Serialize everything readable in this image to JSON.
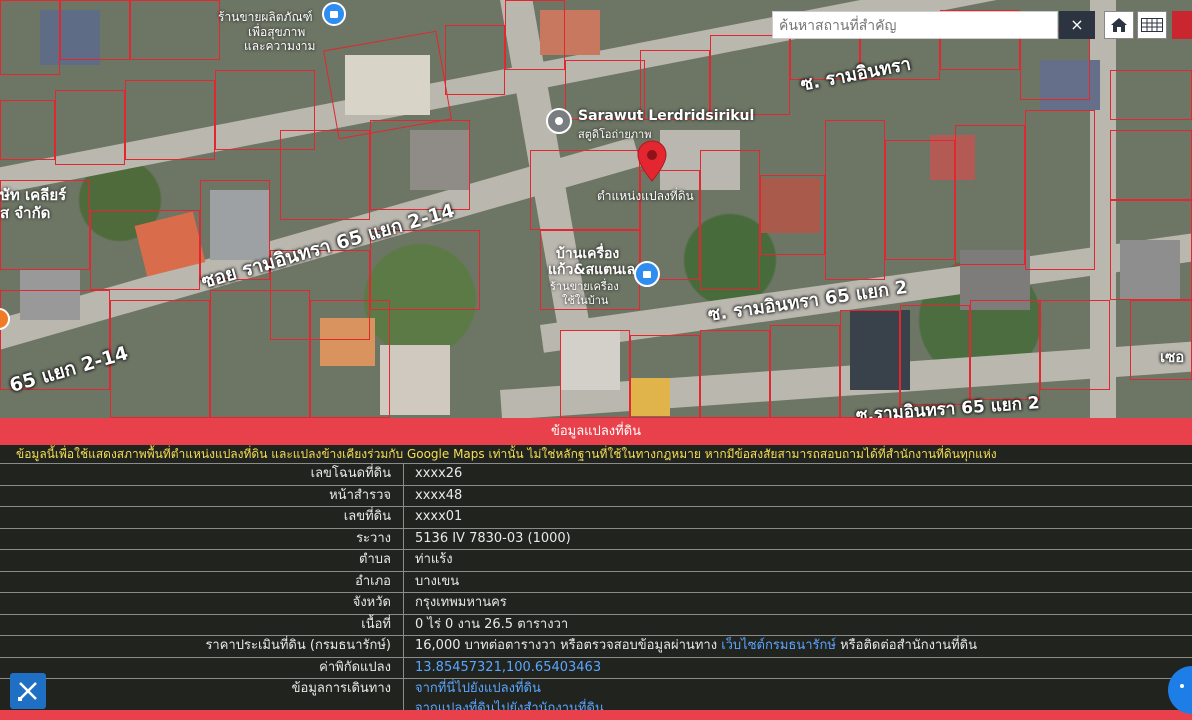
{
  "map": {
    "search_placeholder": "ค้นหาสถานที่สำคัญ",
    "close_label": "×",
    "road_labels": {
      "soi_2_14": "ซอย รามอินทรา 65 แยก 2-14",
      "soi_2_14_left": "65 แยก 2-14",
      "soi_2": "ซ. รามอินทรา 65 แยก 2",
      "soi_top": "ซ. รามอินทรา",
      "soi_bottom_right": "ซ.รามอินทรา 65 แยก 2",
      "edge_right": "เซอ"
    },
    "pois": {
      "sarawut_name": "Sarawut Lerdridsirikul",
      "sarawut_desc": "สตูดิโอถ่ายภาพ",
      "store_name_1": "บ้านเครื่อง",
      "store_name_2": "แก้ว&สแตนเลส",
      "store_desc_1": "ร้านขายเครื่อง",
      "store_desc_2": "ใช้ในบ้าน",
      "top_poi_1": "ร้านขายผลิตภัณฑ์",
      "top_poi_2": "เพื่อสุขภาพ",
      "top_poi_3": "และความงาม",
      "left_poi_1": "ษัท เคลียร์",
      "left_poi_2": "ส จำกัด"
    },
    "pin_label": "ตำแหน่งแปลงที่ดิน"
  },
  "panel": {
    "title": "ข้อมูลแปลงที่ดิน",
    "notice": "ข้อมูลนี้เพื่อใช้แสดงสภาพพื้นที่ตำแหน่งแปลงที่ดิน และแปลงข้างเคียงร่วมกับ Google Maps เท่านั้น ไม่ใช่หลักฐานที่ใช้ในทางกฎหมาย หากมีข้อสงสัยสามารถสอบถามได้ที่สำนักงานที่ดินทุกแห่ง",
    "rows": [
      {
        "label": "เลขโฉนดที่ดิน",
        "value": "xxxx26"
      },
      {
        "label": "หน้าสำรวจ",
        "value": "xxxx48"
      },
      {
        "label": "เลขที่ดิน",
        "value": "xxxx01"
      },
      {
        "label": "ระวาง",
        "value": "5136 IV 7830-03 (1000)"
      },
      {
        "label": "ตำบล",
        "value": "ท่าแร้ง"
      },
      {
        "label": "อำเภอ",
        "value": "บางเขน"
      },
      {
        "label": "จังหวัด",
        "value": "กรุงเทพมหานคร"
      },
      {
        "label": "เนื้อที่",
        "value": "0 ไร่ 0 งาน 26.5 ตารางวา"
      }
    ],
    "price": {
      "label": "ราคาประเมินที่ดิน (กรมธนารักษ์)",
      "value_pre": "16,000 บาทต่อตารางวา หรือตรวจสอบข้อมูลผ่านทาง",
      "link": "เว็บไซต์กรมธนารักษ์",
      "value_post": "หรือติดต่อสำนักงานที่ดิน"
    },
    "coords": {
      "label": "ค่าพิกัดแปลง",
      "value": "13.85457321,100.65403463"
    },
    "travel": {
      "label": "ข้อมูลการเดินทาง",
      "link1": "จากที่นี่ไปยังแปลงที่ดิน",
      "link2": "จากแปลงที่ดินไปยังสำนักงานที่ดิน"
    }
  },
  "colors": {
    "accent": "#e8414b",
    "notice": "#f5df55",
    "link": "#5aa6ff",
    "pin": "#e3262f"
  }
}
